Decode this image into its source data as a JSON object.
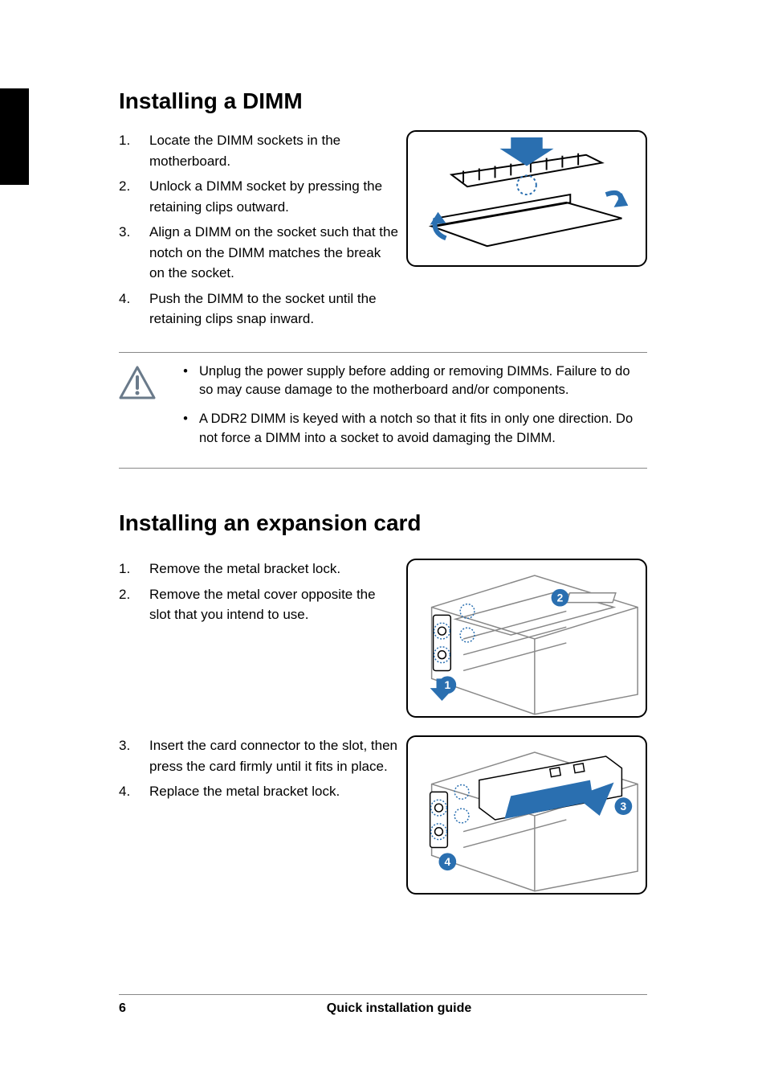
{
  "section1": {
    "heading": "Installing a DIMM",
    "steps": [
      "Locate the DIMM sockets in the motherboard.",
      "Unlock a DIMM socket by pressing the retaining clips outward.",
      "Align a DIMM on the socket such that the notch on the DIMM matches the break on the socket.",
      "Push the DIMM to the socket until the retaining clips snap inward."
    ],
    "notes": [
      "Unplug the power supply before adding or removing DIMMs. Failure to do so may cause damage to the motherboard and/or components.",
      "A DDR2 DIMM is keyed with a notch so that it fits in only one direction. Do not force a DIMM into a socket to avoid damaging the DIMM."
    ]
  },
  "section2": {
    "heading": "Installing an expansion card",
    "steps_a": [
      "Remove the metal bracket lock.",
      "Remove the metal cover opposite the slot that you intend to use."
    ],
    "steps_b": [
      "Insert the card connector to the slot, then press the card firmly until it fits in place.",
      "Replace the metal bracket lock."
    ],
    "fig2_labels": {
      "l1": "1",
      "l2": "2"
    },
    "fig3_labels": {
      "l3": "3",
      "l4": "4"
    }
  },
  "footer": {
    "page": "6",
    "title": "Quick installation guide"
  }
}
